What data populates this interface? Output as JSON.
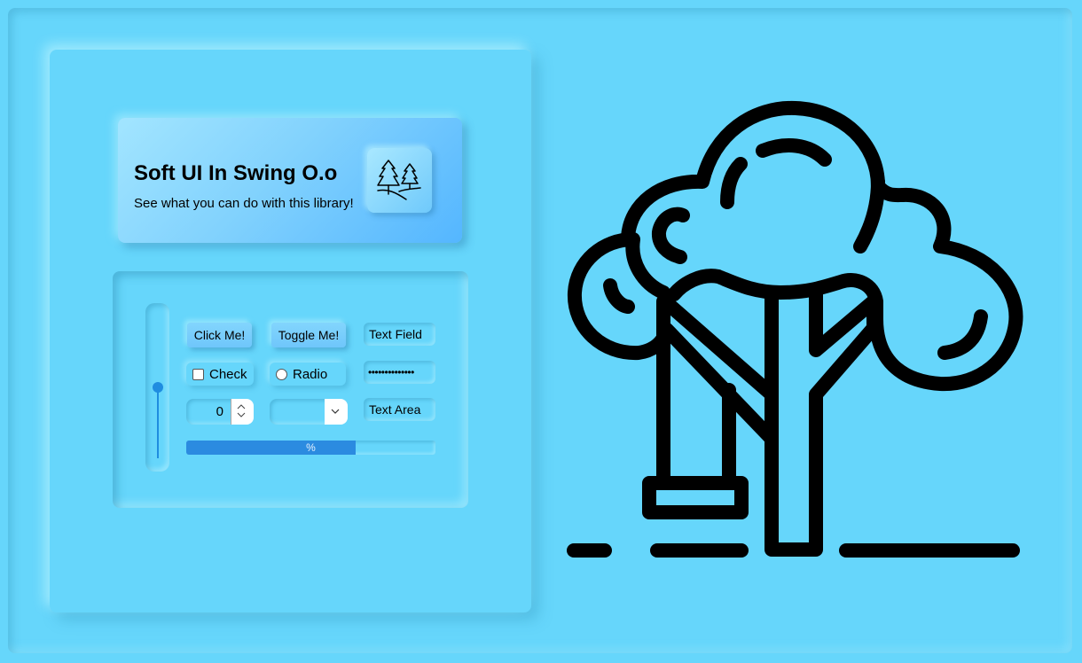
{
  "hero": {
    "title": "Soft UI In Swing O.o",
    "subtitle": "See what you can do with this library!",
    "icon": "trees-icon"
  },
  "controls": {
    "slider": {
      "value": 0.5
    },
    "click_button": "Click Me!",
    "toggle_button": "Toggle Me!",
    "text_field": "Text Field",
    "checkbox": {
      "label": "Check",
      "checked": false
    },
    "radio": {
      "label": "Radio",
      "selected": false
    },
    "password_field": "••••••••••••••",
    "spinner": {
      "value": "0"
    },
    "combo": {
      "selected": ""
    },
    "text_area": "Text Area",
    "progress": {
      "value": 0.68,
      "text": "%"
    }
  },
  "illustration": {
    "icon": "tree-swing-icon"
  },
  "colors": {
    "background": "#66d6fb",
    "accent": "#1f8de0"
  }
}
